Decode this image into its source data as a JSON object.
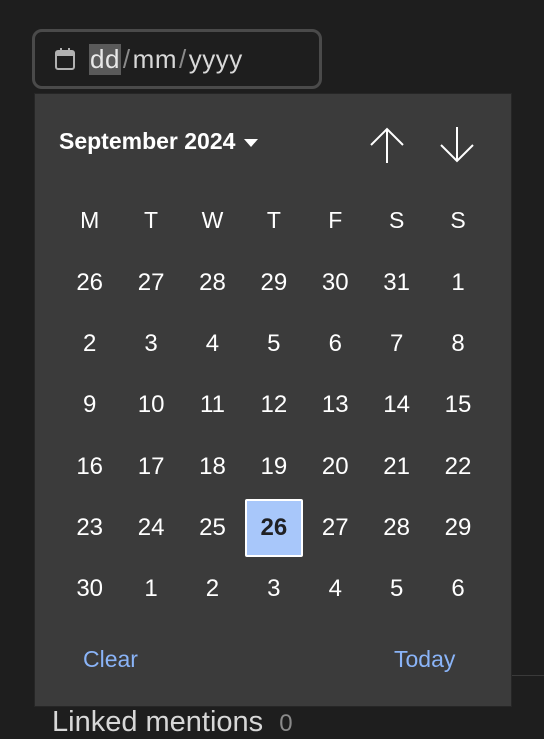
{
  "date_input": {
    "day_placeholder": "dd",
    "month_placeholder": "mm",
    "year_placeholder": "yyyy",
    "separator": "/",
    "icon": "calendar-icon"
  },
  "picker": {
    "month_label": "September 2024",
    "prev_icon": "arrow-up-icon",
    "next_icon": "arrow-down-icon",
    "weekdays": [
      "M",
      "T",
      "W",
      "T",
      "F",
      "S",
      "S"
    ],
    "weeks": [
      [
        "26",
        "27",
        "28",
        "29",
        "30",
        "31",
        "1"
      ],
      [
        "2",
        "3",
        "4",
        "5",
        "6",
        "7",
        "8"
      ],
      [
        "9",
        "10",
        "11",
        "12",
        "13",
        "14",
        "15"
      ],
      [
        "16",
        "17",
        "18",
        "19",
        "20",
        "21",
        "22"
      ],
      [
        "23",
        "24",
        "25",
        "26",
        "27",
        "28",
        "29"
      ],
      [
        "30",
        "1",
        "2",
        "3",
        "4",
        "5",
        "6"
      ]
    ],
    "selected": {
      "week": 4,
      "day": 3
    },
    "clear_label": "Clear",
    "today_label": "Today"
  },
  "background": {
    "linked_mentions_label": "Linked mentions",
    "linked_mentions_count": "0"
  },
  "colors": {
    "accent": "#8ab4f8",
    "selected_bg": "#a8c7fa",
    "picker_bg": "#3b3b3b",
    "page_bg": "#1e1e1e"
  }
}
